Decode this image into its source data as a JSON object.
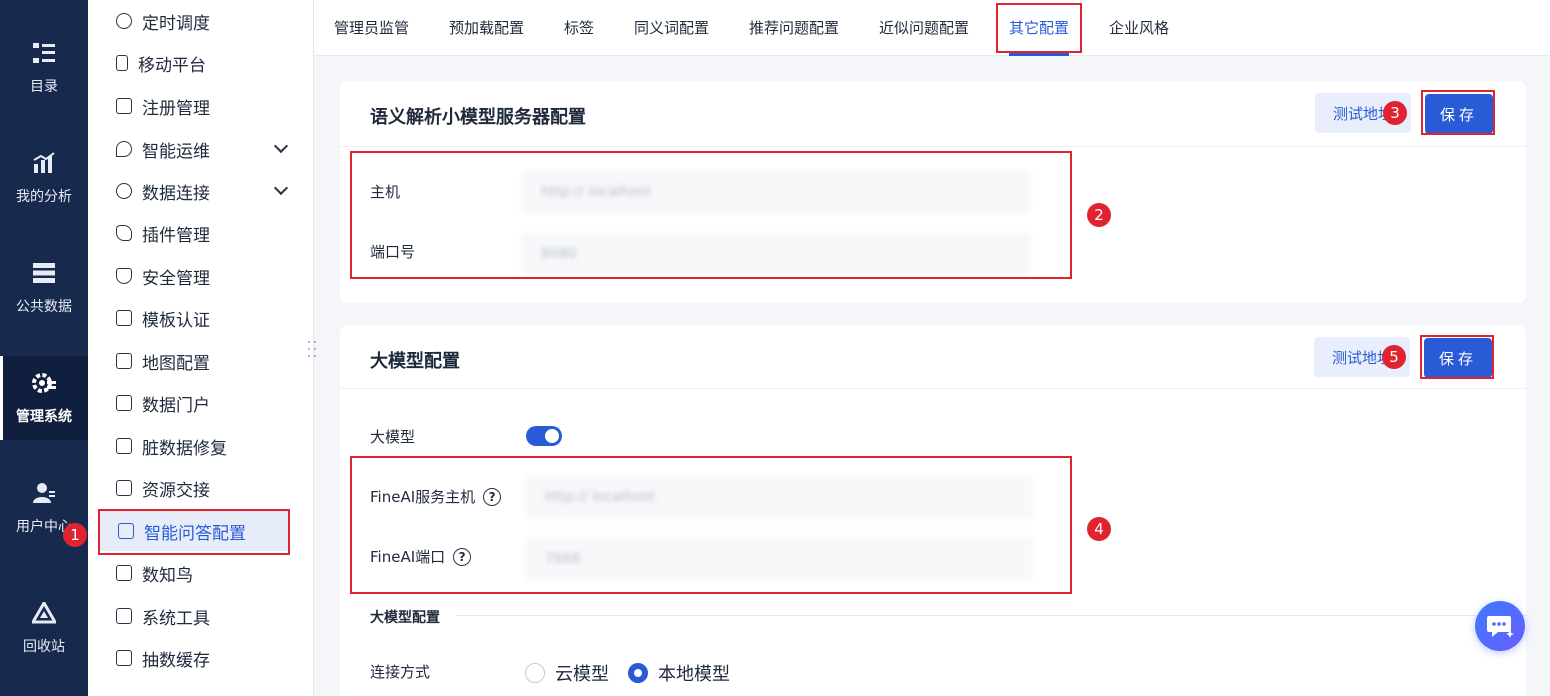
{
  "rail": {
    "items": [
      {
        "label": "目录",
        "icon": "catalog-icon"
      },
      {
        "label": "我的分析",
        "icon": "analysis-icon"
      },
      {
        "label": "公共数据",
        "icon": "database-icon"
      },
      {
        "label": "管理系统",
        "icon": "gear-manage-icon"
      },
      {
        "label": "用户中心",
        "icon": "user-icon"
      },
      {
        "label": "回收站",
        "icon": "recycle-icon"
      }
    ]
  },
  "menu": {
    "items": [
      {
        "label": "定时调度"
      },
      {
        "label": "移动平台"
      },
      {
        "label": "注册管理"
      },
      {
        "label": "智能运维"
      },
      {
        "label": "数据连接"
      },
      {
        "label": "插件管理"
      },
      {
        "label": "安全管理"
      },
      {
        "label": "模板认证"
      },
      {
        "label": "地图配置"
      },
      {
        "label": "数据门户"
      },
      {
        "label": "脏数据修复"
      },
      {
        "label": "资源交接"
      },
      {
        "label": "智能问答配置"
      },
      {
        "label": "数知鸟"
      },
      {
        "label": "系统工具"
      },
      {
        "label": "抽数缓存"
      }
    ]
  },
  "tabs": [
    {
      "label": "管理员监管"
    },
    {
      "label": "预加载配置"
    },
    {
      "label": "标签"
    },
    {
      "label": "同义词配置"
    },
    {
      "label": "推荐问题配置"
    },
    {
      "label": "近似问题配置"
    },
    {
      "label": "其它配置"
    },
    {
      "label": "企业风格"
    }
  ],
  "card1": {
    "title": "语义解析小模型服务器配置",
    "test_label": "测试地址",
    "save_label": "保存",
    "host_label": "主机",
    "host_value": "http:// localhost",
    "port_label": "端口号",
    "port_value": "8080"
  },
  "card2": {
    "title": "大模型配置",
    "test_label": "测试地址",
    "save_label": "保存",
    "switch_label": "大模型",
    "host_label": "FineAI服务主机",
    "host_value": "http:// localhost",
    "port_label": "FineAI端口",
    "port_value": "7666",
    "section_title": "大模型配置",
    "connect_label": "连接方式",
    "radio_cloud": "云模型",
    "radio_local": "本地模型"
  },
  "badges": [
    "1",
    "2",
    "3",
    "4",
    "5"
  ],
  "help_glyph": "?",
  "colors": {
    "rail_bg": "#172a4e",
    "accent": "#2a5bd7",
    "highlight": "#e0242f"
  }
}
